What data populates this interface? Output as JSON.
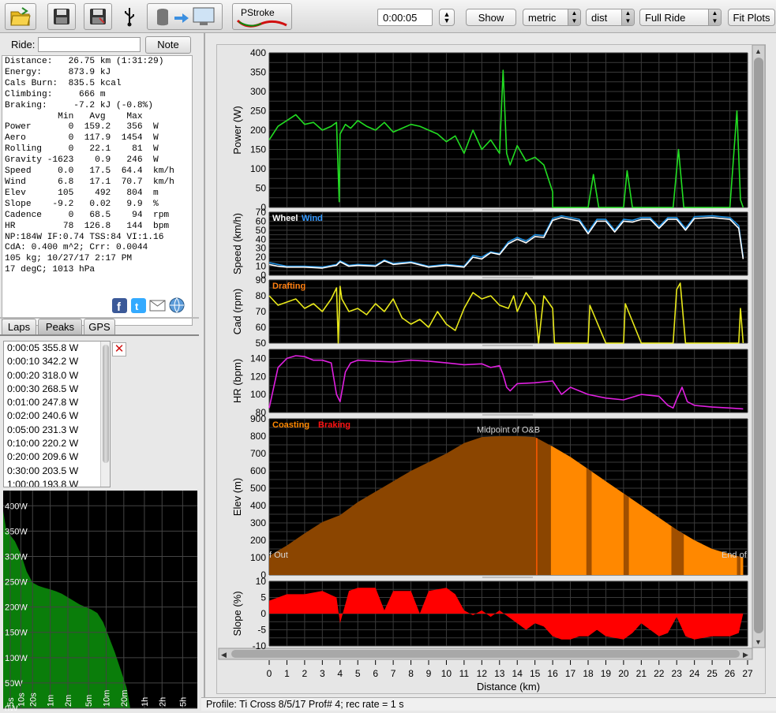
{
  "toolbar": {
    "title_button": "PStroke",
    "time_value": "0:00:05",
    "show_label": "Show",
    "units_selected": "metric",
    "axis_selected": "dist",
    "range_selected": "Full Ride",
    "fit_label": "Fit Plots",
    "icons": [
      "open-folder-icon",
      "save-icon",
      "save-as-icon",
      "usb-icon",
      "download-to-computer-icon"
    ]
  },
  "ride": {
    "label": "Ride:",
    "input_value": "",
    "note_label": "Note"
  },
  "summary": {
    "lines": [
      "Distance:   26.75 km (1:31:29)",
      "Energy:     873.9 kJ",
      "Cals Burn:  835.5 kcal",
      "Climbing:     666 m",
      "Braking:     -7.2 kJ (-0.8%)",
      "          Min   Avg    Max",
      "Power       0  159.2   356  W",
      "Aero        0  117.9  1454  W",
      "Rolling     0   22.1    81  W",
      "Gravity -1623    0.9   246  W",
      "Speed     0.0   17.5  64.4  km/h",
      "Wind      6.8   17.1  70.7  km/h",
      "Elev      105    492   804  m",
      "Slope    -9.2   0.02   9.9  %",
      "Cadence     0   68.5    94  rpm",
      "HR         78  126.8   144  bpm",
      "NP:184W IF:0.74 TSS:84 VI:1.16",
      "CdA: 0.400 m^2; Crr: 0.0044",
      "105 kg; 10/27/17 2:17 PM",
      "17 degC; 1013 hPa"
    ]
  },
  "share_icons": [
    "facebook-icon",
    "twitter-icon",
    "email-icon",
    "web-icon"
  ],
  "tabs": [
    {
      "label": "Laps",
      "active": false
    },
    {
      "label": "Peaks",
      "active": true
    },
    {
      "label": "GPS",
      "active": false
    }
  ],
  "peaks": [
    "0:00:05 355.8 W",
    "0:00:10 342.2 W",
    "0:00:20 318.0 W",
    "0:00:30 268.5 W",
    "0:01:00 247.8 W",
    "0:02:00 240.6 W",
    "0:05:00 231.3 W",
    "0:10:00 220.2 W",
    "0:20:00 209.6 W",
    "0:30:00 203.5 W",
    "1:00:00 193.8 W"
  ],
  "peak_curve": {
    "y_labels": [
      "400W",
      "350W",
      "300W",
      "250W",
      "200W",
      "150W",
      "100W",
      "50W",
      "0W"
    ],
    "x_labels": [
      "5s",
      "10s",
      "20s",
      "1m",
      "2m",
      "5m",
      "10m",
      "20m",
      "1h",
      "2h",
      "5h"
    ],
    "points": [
      [
        0,
        390
      ],
      [
        0.5,
        355
      ],
      [
        1,
        345
      ],
      [
        2,
        330
      ],
      [
        3,
        305
      ],
      [
        4,
        270
      ],
      [
        5,
        248
      ],
      [
        6,
        242
      ],
      [
        7,
        238
      ],
      [
        8,
        235
      ],
      [
        9,
        231
      ],
      [
        10,
        226
      ],
      [
        11,
        219
      ],
      [
        12,
        212
      ],
      [
        13,
        205
      ],
      [
        14,
        200
      ],
      [
        15,
        195
      ],
      [
        16,
        188
      ],
      [
        17,
        170
      ],
      [
        18,
        140
      ],
      [
        19,
        110
      ],
      [
        20,
        75
      ],
      [
        21,
        40
      ],
      [
        21.6,
        0
      ]
    ],
    "x_max": 33,
    "y_max": 430,
    "colors": {
      "fill": "#0a7d0a",
      "grid": "#444444",
      "bg": "#000000",
      "text": "#ffffff"
    }
  },
  "status": {
    "text": "Profile: Ti Cross 8/5/17 Prof# 4; rec rate = 1 s"
  },
  "chart_data": [
    {
      "type": "line",
      "id": "power",
      "ylabel": "Power (W)",
      "ylim": [
        0,
        400
      ],
      "yticks": [
        0,
        50,
        100,
        150,
        200,
        250,
        300,
        350,
        400
      ],
      "series": [
        {
          "color": "#22dd22",
          "x": [
            0,
            0.5,
            1,
            1.5,
            2,
            2.5,
            3,
            3.5,
            3.8,
            3.95,
            4,
            4.3,
            4.6,
            5,
            5.5,
            6,
            6.5,
            7,
            7.5,
            8,
            8.5,
            9,
            9.5,
            10,
            10.5,
            11,
            11.5,
            12,
            12.5,
            13,
            13.2,
            13.4,
            13.6,
            14,
            14.5,
            15,
            15.5,
            16,
            16,
            17,
            18,
            18.3,
            18.6,
            19,
            20,
            20.2,
            20.5,
            21,
            22,
            22.8,
            23.1,
            23.4,
            24,
            25,
            26,
            26.4,
            26.6,
            26.75
          ],
          "y": [
            175,
            210,
            225,
            240,
            215,
            220,
            200,
            210,
            220,
            15,
            190,
            215,
            205,
            225,
            210,
            200,
            220,
            195,
            205,
            215,
            210,
            200,
            190,
            170,
            185,
            140,
            200,
            150,
            175,
            140,
            355,
            140,
            110,
            160,
            120,
            130,
            110,
            40,
            0,
            0,
            0,
            85,
            0,
            0,
            0,
            95,
            0,
            0,
            0,
            0,
            150,
            0,
            0,
            0,
            0,
            250,
            20,
            0
          ]
        }
      ]
    },
    {
      "type": "line",
      "id": "speed",
      "ylabel": "Speed (km/h)",
      "ylim": [
        0,
        70
      ],
      "yticks": [
        0,
        10,
        20,
        30,
        40,
        50,
        60,
        70
      ],
      "legend": [
        {
          "name": "Wheel",
          "color": "#ffffff"
        },
        {
          "name": "Wind",
          "color": "#3399ff"
        }
      ],
      "series": [
        {
          "name": "Wind",
          "color": "#1f8fe0",
          "x": [
            0,
            0.5,
            1,
            2,
            3,
            3.8,
            4,
            4.5,
            5,
            6,
            6.5,
            7,
            8,
            9,
            10,
            11,
            11.5,
            12,
            12.5,
            13,
            13.5,
            14,
            14.5,
            15,
            15.5,
            16,
            16.5,
            17,
            17.5,
            18,
            18.5,
            19,
            19.5,
            20,
            20.5,
            21,
            21.5,
            22,
            22.5,
            23,
            23.5,
            24,
            25,
            26,
            26.5,
            26.75
          ],
          "y": [
            14,
            12,
            10,
            10,
            9,
            12,
            16,
            11,
            12,
            11,
            17,
            13,
            15,
            10,
            12,
            10,
            22,
            20,
            26,
            24,
            37,
            42,
            38,
            45,
            44,
            63,
            66,
            64,
            62,
            48,
            62,
            62,
            50,
            62,
            61,
            64,
            64,
            54,
            64,
            64,
            52,
            65,
            66,
            64,
            55,
            20
          ]
        },
        {
          "name": "Wheel",
          "color": "#ffffff",
          "x": [
            0,
            0.5,
            1,
            2,
            3,
            3.8,
            4,
            4.5,
            5,
            6,
            6.5,
            7,
            8,
            9,
            10,
            11,
            11.5,
            12,
            12.5,
            13,
            13.5,
            14,
            14.5,
            15,
            15.5,
            16,
            16.5,
            17,
            17.5,
            18,
            18.5,
            19,
            19.5,
            20,
            20.5,
            21,
            21.5,
            22,
            22.5,
            23,
            23.5,
            24,
            25,
            26,
            26.5,
            26.75
          ],
          "y": [
            12,
            10,
            9,
            9,
            8,
            11,
            15,
            10,
            11,
            10,
            16,
            12,
            14,
            9,
            11,
            9,
            20,
            18,
            25,
            23,
            35,
            40,
            36,
            43,
            42,
            61,
            64,
            62,
            60,
            46,
            60,
            60,
            48,
            60,
            59,
            62,
            62,
            52,
            62,
            62,
            50,
            63,
            64,
            62,
            52,
            18
          ]
        }
      ]
    },
    {
      "type": "line",
      "id": "cadence",
      "ylabel": "Cad (rpm)",
      "ylim": [
        50,
        90
      ],
      "yticks": [
        50,
        60,
        70,
        80,
        90
      ],
      "legend": [
        {
          "name": "Drafting",
          "color": "#ff7f11"
        }
      ],
      "series": [
        {
          "color": "#e8e81a",
          "x": [
            0,
            0.5,
            1,
            1.5,
            2,
            2.5,
            3,
            3.5,
            3.8,
            3.9,
            4,
            4.1,
            4.5,
            5,
            5.5,
            6,
            6.5,
            7,
            7.5,
            8,
            8.5,
            9,
            9.5,
            10,
            10.5,
            11,
            11.5,
            12,
            12.5,
            13,
            13.5,
            13.8,
            14,
            14.5,
            15,
            15.2,
            15.5,
            16,
            16.1,
            17,
            18,
            18.1,
            19,
            20,
            20.1,
            21,
            22,
            22.8,
            23,
            23.2,
            23.5,
            24,
            25,
            26,
            26.5,
            26.6,
            26.75
          ],
          "y": [
            80,
            74,
            76,
            78,
            72,
            75,
            70,
            78,
            85,
            50,
            86,
            78,
            70,
            72,
            68,
            75,
            70,
            78,
            66,
            62,
            65,
            60,
            70,
            62,
            58,
            72,
            82,
            78,
            80,
            74,
            72,
            80,
            70,
            82,
            74,
            50,
            80,
            72,
            50,
            50,
            50,
            74,
            50,
            50,
            75,
            50,
            50,
            50,
            84,
            88,
            50,
            50,
            50,
            50,
            50,
            72,
            50
          ]
        }
      ]
    },
    {
      "type": "line",
      "id": "hr",
      "ylabel": "HR (bpm)",
      "ylim": [
        80,
        150
      ],
      "yticks": [
        80,
        100,
        120,
        140
      ],
      "series": [
        {
          "color": "#e020e0",
          "x": [
            0,
            0.5,
            1,
            1.5,
            2,
            2.5,
            3,
            3.5,
            3.8,
            4,
            4.3,
            4.6,
            5,
            6,
            7,
            8,
            9,
            10,
            11,
            12,
            12.5,
            13,
            13.2,
            13.4,
            13.6,
            14,
            15,
            16,
            16.5,
            17,
            18,
            19,
            20,
            21,
            22,
            22.5,
            22.8,
            23,
            23.3,
            23.6,
            24,
            25,
            26,
            26.75
          ],
          "y": [
            85,
            130,
            140,
            143,
            142,
            138,
            138,
            135,
            100,
            92,
            125,
            135,
            138,
            137,
            136,
            138,
            137,
            135,
            133,
            134,
            130,
            132,
            122,
            108,
            104,
            112,
            113,
            115,
            100,
            108,
            100,
            96,
            94,
            100,
            98,
            88,
            85,
            95,
            108,
            92,
            88,
            86,
            85,
            84
          ]
        }
      ]
    },
    {
      "type": "area",
      "id": "elevation",
      "ylabel": "Elev (m)",
      "ylim": [
        0,
        900
      ],
      "yticks": [
        0,
        100,
        200,
        300,
        400,
        500,
        600,
        700,
        800,
        900
      ],
      "legend": [
        {
          "name": "Coasting",
          "color": "#ff8800"
        },
        {
          "name": "Braking",
          "color": "#ff1111"
        }
      ],
      "annotations": [
        {
          "text": "f Out",
          "x": 0,
          "y": 100
        },
        {
          "text": "Midpoint of O&B",
          "x": 13.5,
          "y": 820
        },
        {
          "text": "End of",
          "x": 26.5,
          "y": 100
        }
      ],
      "series": [
        {
          "color": "#8b4500",
          "x": [
            0,
            1,
            2,
            3,
            4,
            5,
            6,
            7,
            8,
            9,
            10,
            11,
            12,
            13,
            14,
            15,
            16,
            17,
            18,
            19,
            20,
            21,
            22,
            23,
            24,
            25,
            26,
            26.75
          ],
          "y": [
            110,
            170,
            240,
            305,
            345,
            420,
            480,
            540,
            600,
            650,
            700,
            760,
            795,
            800,
            800,
            795,
            740,
            680,
            610,
            540,
            470,
            400,
            330,
            260,
            200,
            150,
            120,
            100
          ]
        }
      ],
      "coasting_ranges": [
        [
          15.9,
          26.75
        ]
      ],
      "dark_bands": [
        [
          17.9,
          18.2
        ],
        [
          20.0,
          20.3
        ],
        [
          22.7,
          23.4
        ],
        [
          26.4,
          26.6
        ]
      ],
      "braking_marks": [
        15.1
      ]
    },
    {
      "type": "area",
      "id": "slope",
      "ylabel": "Slope (%)",
      "ylim": [
        -10,
        10
      ],
      "yticks": [
        -10,
        -5,
        0,
        5,
        10
      ],
      "series": [
        {
          "color": "#ff0000",
          "x": [
            0,
            0.5,
            1,
            2,
            3,
            3.8,
            4,
            4.5,
            5,
            6,
            6.5,
            7,
            8,
            8.5,
            9,
            10,
            10.5,
            11,
            11.5,
            12,
            12.5,
            13,
            13.5,
            14,
            14.5,
            15,
            15.5,
            16,
            16.5,
            17,
            17.5,
            18,
            18.5,
            19,
            20,
            20.5,
            21,
            22,
            22.5,
            23,
            23.5,
            24,
            25,
            26,
            26.5,
            26.75
          ],
          "y": [
            4,
            5,
            6,
            6,
            7,
            5,
            -3,
            7,
            8,
            8,
            1,
            7,
            7,
            0,
            7,
            8,
            6,
            1,
            -0.5,
            1,
            -1,
            1,
            -1,
            -3,
            -5,
            -3,
            -4,
            -7,
            -8,
            -8,
            -7,
            -7,
            -5,
            -7,
            -8,
            -6,
            -3,
            -7,
            -6,
            -1,
            -7,
            -8,
            -7,
            -7,
            -6,
            0
          ]
        }
      ]
    }
  ],
  "x_axis": {
    "label": "Distance (km)",
    "xlim": [
      0,
      27
    ],
    "ticks": [
      0,
      1,
      2,
      3,
      4,
      5,
      6,
      7,
      8,
      9,
      10,
      11,
      12,
      13,
      14,
      15,
      16,
      17,
      18,
      19,
      20,
      21,
      22,
      23,
      24,
      25,
      26,
      27
    ]
  }
}
